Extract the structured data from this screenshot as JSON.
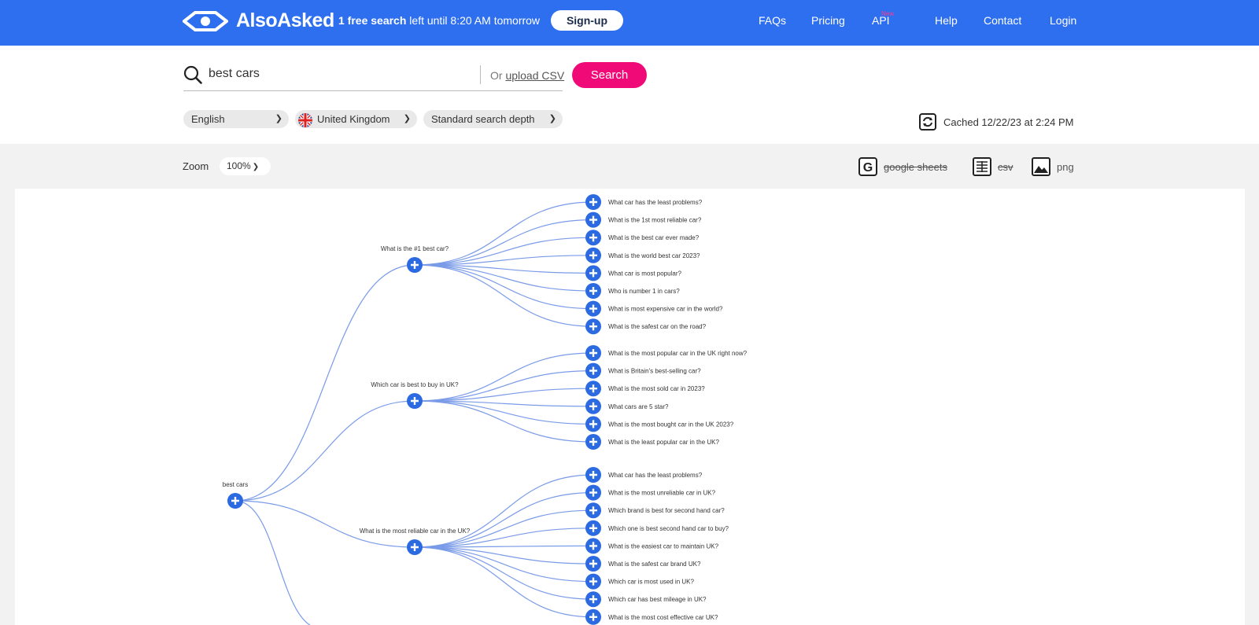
{
  "header": {
    "brand": "AlsoAsked",
    "free_search_bold": "1 free search",
    "free_search_rest": " left until 8:20 AM tomorrow",
    "signup": "Sign-up",
    "nav": [
      "FAQs",
      "Pricing",
      "API",
      "Help",
      "Contact",
      "Login"
    ],
    "api_badge": "New"
  },
  "search": {
    "query": "best cars",
    "or_text": "Or",
    "upload_csv": "upload CSV",
    "button": "Search"
  },
  "filters": {
    "language": "English",
    "country": "United Kingdom",
    "depth": "Standard search depth",
    "cached": "Cached 12/22/23 at 2:24 PM"
  },
  "toolbar": {
    "zoom_label": "Zoom",
    "zoom_value": "100%",
    "exports": [
      "google sheets",
      "csv",
      "png"
    ]
  },
  "tree": {
    "root": "best cars",
    "branches": [
      {
        "question": "What is the #1 best car?",
        "children": [
          "What car has the least problems?",
          "What is the 1st most reliable car?",
          "What is the best car ever made?",
          "What is the world best car 2023?",
          "What car is most popular?",
          "Who is number 1 in cars?",
          "What is most expensive car in the world?",
          "What is the safest car on the road?"
        ]
      },
      {
        "question": "Which car is best to buy in UK?",
        "children": [
          "What is the most popular car in the UK right now?",
          "What is Britain's best-selling car?",
          "What is the most sold car in 2023?",
          "What cars are 5 star?",
          "What is the most bought car in the UK 2023?",
          "What is the least popular car in the UK?"
        ]
      },
      {
        "question": "What is the most reliable car in the UK?",
        "children": [
          "What car has the least problems?",
          "What is the most unreliable car in UK?",
          "Which brand is best for second hand car?",
          "Which one is best second hand car to buy?",
          "What is the easiest car to maintain UK?",
          "What is the safest car brand UK?",
          "Which car is most used in UK?",
          "Which car has best mileage in UK?",
          "What is the most cost effective car UK?"
        ]
      }
    ]
  },
  "colors": {
    "brand_blue": "#2e6ff0",
    "search_pink": "#f00a78",
    "node_blue": "#2b6ae0",
    "link_blue": "#7a9be8"
  }
}
